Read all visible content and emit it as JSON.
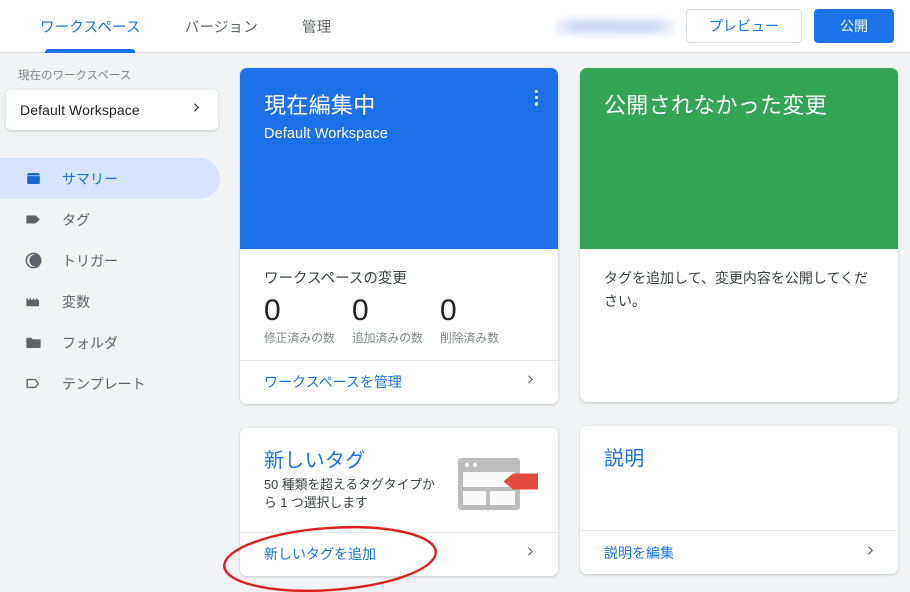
{
  "header": {
    "tabs": [
      {
        "label": "ワークスペース",
        "active": true
      },
      {
        "label": "バージョン",
        "active": false
      },
      {
        "label": "管理",
        "active": false
      }
    ],
    "account_redacted": "",
    "preview_label": "プレビュー",
    "publish_label": "公開"
  },
  "sidebar": {
    "section_label": "現在のワークスペース",
    "workspace_name": "Default Workspace",
    "items": [
      {
        "label": "サマリー",
        "icon": "summary-icon",
        "active": true
      },
      {
        "label": "タグ",
        "icon": "tag-icon",
        "active": false
      },
      {
        "label": "トリガー",
        "icon": "trigger-icon",
        "active": false
      },
      {
        "label": "変数",
        "icon": "variable-icon",
        "active": false
      },
      {
        "label": "フォルダ",
        "icon": "folder-icon",
        "active": false
      },
      {
        "label": "テンプレート",
        "icon": "template-icon",
        "active": false
      }
    ]
  },
  "cards": {
    "editing": {
      "title": "現在編集中",
      "subtitle": "Default Workspace",
      "stats_label": "ワークスペースの変更",
      "stats": [
        {
          "value": "0",
          "caption": "修正済みの数"
        },
        {
          "value": "0",
          "caption": "追加済みの数"
        },
        {
          "value": "0",
          "caption": "削除済み数"
        }
      ],
      "action_label": "ワークスペースを管理"
    },
    "unpublished": {
      "title": "公開されなかった変更",
      "body": "タグを追加して、変更内容を公開してください。"
    },
    "new_tag": {
      "title": "新しいタグ",
      "description": "50 種類を超えるタグタイプから 1 つ選択します",
      "action_label": "新しいタグを追加"
    },
    "description": {
      "title": "説明",
      "action_label": "説明を編集"
    }
  },
  "colors": {
    "accent_blue": "#1a73e8",
    "hero_blue": "#1d71e8",
    "hero_green": "#34a456",
    "page_bg": "#f1f3f4",
    "annotation_red": "#e02020"
  }
}
